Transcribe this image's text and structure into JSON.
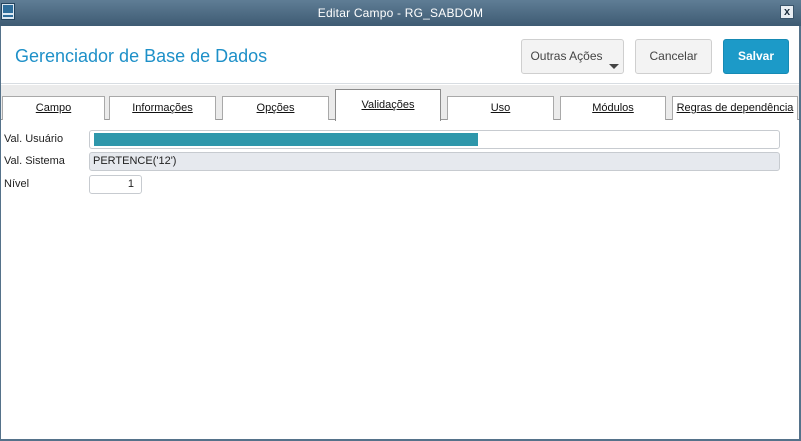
{
  "window": {
    "title": "Editar Campo - RG_SABDOM",
    "close_label": "x"
  },
  "header": {
    "title": "Gerenciador de Base de Dados",
    "other_actions_label": "Outras Ações",
    "cancel_label": "Cancelar",
    "save_label": "Salvar"
  },
  "tabs": [
    {
      "label": "Campo"
    },
    {
      "label": "Informações"
    },
    {
      "label": "Opções"
    },
    {
      "label": "Validações"
    },
    {
      "label": "Uso"
    },
    {
      "label": "Módulos"
    },
    {
      "label": "Regras de dependência"
    }
  ],
  "active_tab": "Validações",
  "form": {
    "val_usuario": {
      "label": "Val. Usuário",
      "value": ""
    },
    "val_sistema": {
      "label": "Val. Sistema",
      "value": "PERTENCE('12')"
    },
    "nivel": {
      "label": "Nível",
      "value": "1"
    }
  },
  "colors": {
    "accent": "#1c9ac8",
    "title_text": "#1e90c8",
    "selection": "#2e97ab",
    "titlebar": "#4a677f"
  },
  "icons": {
    "app": "app-window-icon",
    "close": "close-icon",
    "dropdown": "chevron-down-icon"
  }
}
